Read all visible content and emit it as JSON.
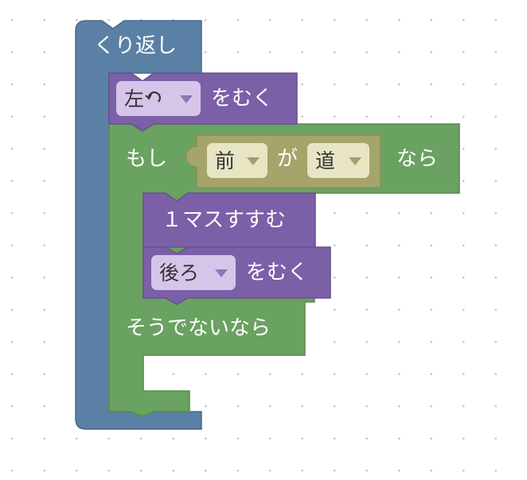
{
  "colors": {
    "loop_block": "#5b80a5",
    "motion_block": "#7b60a8",
    "logic_block": "#6aa261",
    "condition_block": "#a5a46a",
    "dropdown_purple": "#d5c6e9",
    "dropdown_olive": "#e7e5c3",
    "workspace_background": "#ffffff",
    "grid_dot": "#c2c2c2"
  },
  "blocks": {
    "repeat": {
      "label": "くり返し"
    },
    "turn_1": {
      "direction": "左",
      "direction_icon": "turn-left-arrow-icon",
      "label": "をむく"
    },
    "if_else": {
      "if_label": "もし",
      "then_label": "なら",
      "else_label": "そうでないなら",
      "condition": {
        "target": "前",
        "connector": "が",
        "kind": "道"
      }
    },
    "move": {
      "label": "１マスすすむ"
    },
    "turn_2": {
      "direction": "後ろ",
      "label": "をむく"
    }
  }
}
